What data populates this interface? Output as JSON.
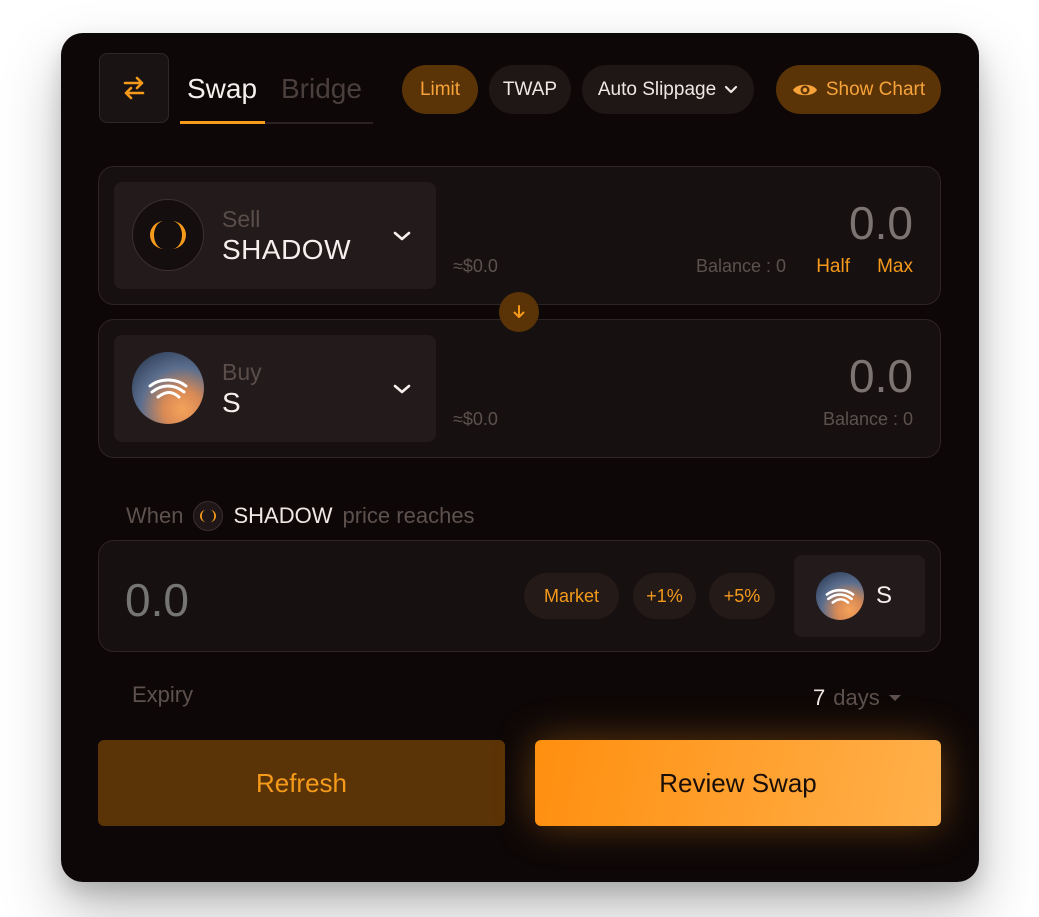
{
  "header": {
    "tabs": [
      {
        "label": "Swap",
        "active": true
      },
      {
        "label": "Bridge",
        "active": false
      }
    ],
    "pills": {
      "limit": "Limit",
      "twap": "TWAP",
      "slippage": "Auto Slippage",
      "chart": "Show Chart"
    }
  },
  "sell": {
    "label": "Sell",
    "symbol": "SHADOW",
    "amount": "0.0",
    "usd": "≈$0.0",
    "balance": "Balance : 0",
    "half": "Half",
    "max": "Max"
  },
  "buy": {
    "label": "Buy",
    "symbol": "S",
    "amount": "0.0",
    "usd": "≈$0.0",
    "balance": "Balance : 0"
  },
  "limit_price": {
    "when": "When",
    "symbol": "SHADOW",
    "reaches": "price reaches",
    "placeholder": "0.0",
    "chips": {
      "market": "Market",
      "plus1": "+1%",
      "plus5": "+5%"
    },
    "quote_symbol": "S"
  },
  "expiry": {
    "label": "Expiry",
    "value": "7",
    "unit": "days"
  },
  "actions": {
    "refresh": "Refresh",
    "review": "Review Swap"
  },
  "colors": {
    "accent": "#f59a1b",
    "accent_dark": "#5a3306",
    "background": "#0d0707"
  },
  "icons": {
    "swap_toggle": "swap-arrows-icon",
    "chevron": "chevron-down-icon",
    "eye": "eye-icon",
    "flip": "arrow-down-icon"
  }
}
